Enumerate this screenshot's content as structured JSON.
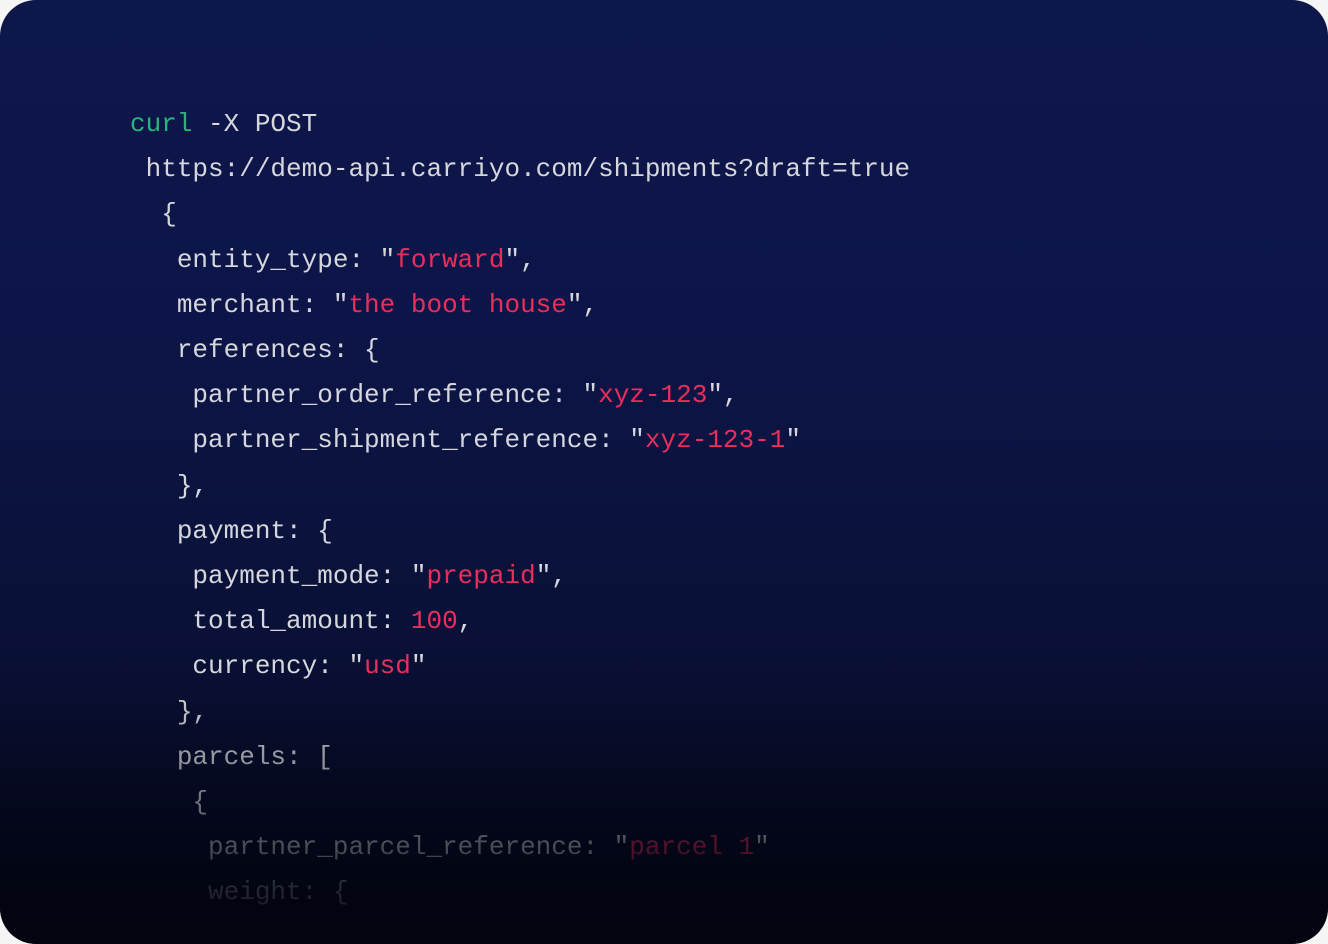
{
  "code": {
    "cmd": "curl",
    "method_flag": " -X POST",
    "url": "https://demo-api.carriyo.com/shipments?draft=true",
    "body": {
      "open": "{",
      "entity_type_key": "entity_type: \"",
      "entity_type_val": "forward",
      "entity_type_close": "\",",
      "merchant_key": "merchant: \"",
      "merchant_val": "the boot house",
      "merchant_close": "\",",
      "references_key": "references: {",
      "partner_order_key": "partner_order_reference: \"",
      "partner_order_val": "xyz-123",
      "partner_order_close": "\",",
      "partner_shipment_key": "partner_shipment_reference: \"",
      "partner_shipment_val": "xyz-123-1",
      "partner_shipment_close": "\"",
      "references_close": "},",
      "payment_key": "payment: {",
      "payment_mode_key": "payment_mode: \"",
      "payment_mode_val": "prepaid",
      "payment_mode_close": "\",",
      "total_amount_key": "total_amount: ",
      "total_amount_val": "100",
      "total_amount_close": ",",
      "currency_key": "currency: \"",
      "currency_val": "usd",
      "currency_close": "\"",
      "payment_close": "},",
      "parcels_key": "parcels: [",
      "parcel_open": "{",
      "partner_parcel_key": "partner_parcel_reference: \"",
      "partner_parcel_val": "parcel 1",
      "partner_parcel_close": "\"",
      "weight_key": "weight: {"
    }
  },
  "indent": {
    "i1": " ",
    "i2": "  ",
    "i3": "   ",
    "i4": "    ",
    "i5": "     "
  }
}
